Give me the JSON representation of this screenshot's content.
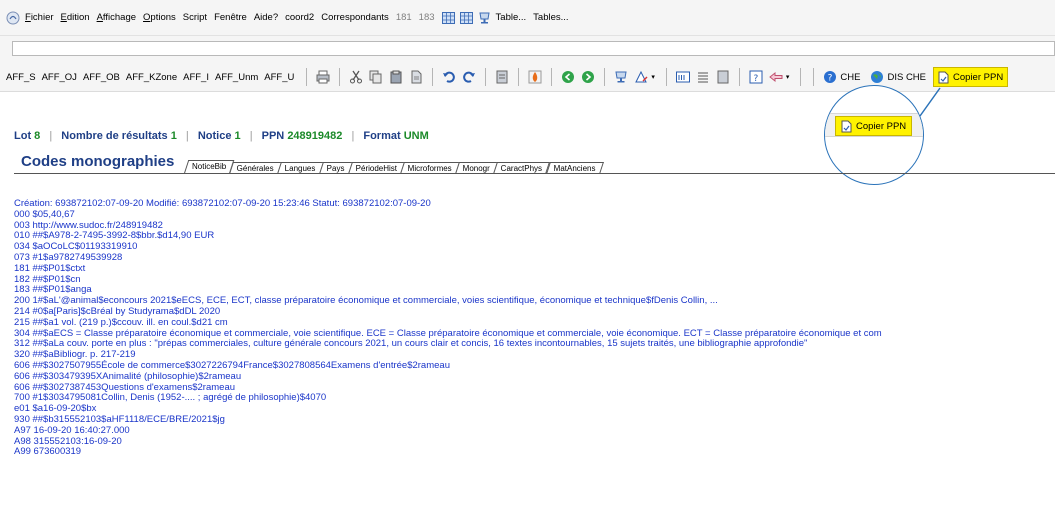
{
  "menubar": {
    "items": [
      "Fichier",
      "Edition",
      "Affichage",
      "Options",
      "Script",
      "Fenêtre",
      "Aide?",
      "coord2",
      "Correspondants"
    ],
    "num1": "181",
    "num2": "183",
    "table_label": "Table...",
    "tables_label": "Tables..."
  },
  "toolbar": {
    "aff": [
      "AFF_S",
      "AFF_OJ",
      "AFF_OB",
      "AFF_KZone",
      "AFF_I",
      "AFF_Unm",
      "AFF_U"
    ],
    "che_label": "CHE",
    "dis_che_label": "DIS CHE",
    "copier_label": "Copier PPN"
  },
  "zoom": {
    "copier_label": "Copier PPN"
  },
  "colors": {
    "highlight": "#fff200",
    "callout": "#2b73b9",
    "record_text": "#1a35c9",
    "title": "#1f3f86",
    "value_green": "#1c8a2a"
  },
  "info": {
    "lot_label": "Lot",
    "lot_value": "8",
    "results_label": "Nombre de résultats",
    "results_value": "1",
    "notice_label": "Notice",
    "notice_value": "1",
    "ppn_label": "PPN",
    "ppn_value": "248919482",
    "format_label": "Format",
    "format_value": "UNM"
  },
  "section_title": "Codes monographies",
  "tabs": [
    "NoticeBib",
    "Générales",
    "Langues",
    "Pays",
    "PériodeHist",
    "Microformes",
    "Monogr",
    "CaractPhys",
    "MatAnciens"
  ],
  "record": [
    "Création: 693872102:07-09-20 Modifié: 693872102:07-09-20 15:23:46 Statut: 693872102:07-09-20",
    "000 $05,40,67",
    "003 http://www.sudoc.fr/248919482",
    "010 ##$A978-2-7495-3992-8$bbr.$d14,90 EUR",
    "034 $aOCoLC$01193319910",
    "073 #1$a9782749539928",
    "181 ##$P01$ctxt",
    "182 ##$P01$cn",
    "183 ##$P01$anga",
    "200 1#$aL'@animal$econcours 2021$eECS, ECE, ECT, classe préparatoire économique et commerciale, voies scientifique, économique et technique$fDenis Collin, ...",
    "214 #0$a[Paris]$cBréal by Studyrama$dDL 2020",
    "215 ##$a1 vol. (219 p.)$ccouv. ill. en coul.$d21 cm",
    "304 ##$aECS = Classe préparatoire économique et commerciale, voie scientifique. ECE = Classe préparatoire économique et commerciale, voie économique. ECT = Classe préparatoire économique et com",
    "312 ##$aLa couv. porte en plus : \"prépas commerciales, culture générale concours 2021, un cours clair et concis, 16 textes incontournables, 15 sujets traités, une bibliographie approfondie\"",
    "320 ##$aBibliogr. p. 217-219",
    "606 ##$3027507955École de commerce$3027226794France$3027808564Examens d'entrée$2rameau",
    "606 ##$303479395XAnimalité (philosophie)$2rameau",
    "606 ##$3027387453Questions d'examens$2rameau",
    "700 #1$3034795081Collin, Denis (1952-.... ; agrégé de philosophie)$4070",
    "e01 $a16-09-20$bx",
    "930 ##$b315552103$aHF1118/ECE/BRE/2021$jg",
    "A97 16-09-20 16:40:27.000",
    "A98 315552103:16-09-20",
    "A99 673600319"
  ]
}
